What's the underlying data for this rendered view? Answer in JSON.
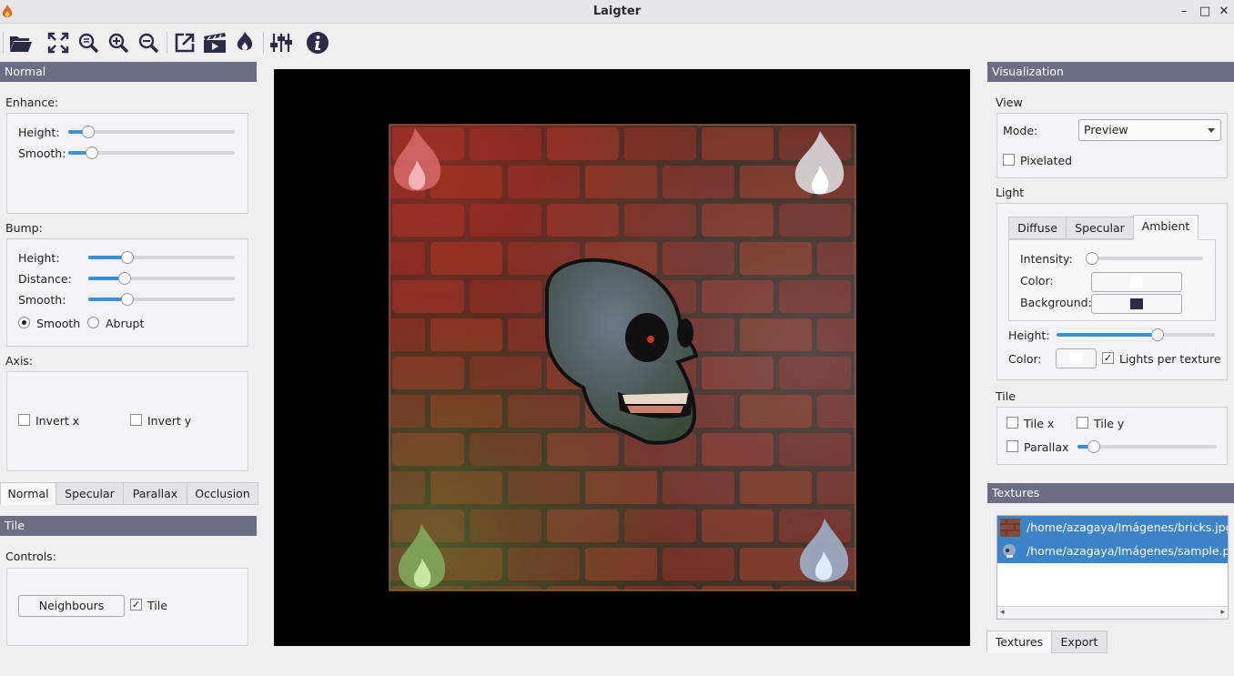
{
  "window": {
    "title": "Laigter"
  },
  "toolbar": {
    "items": [
      {
        "name": "open-folder-icon"
      },
      {
        "name": "fit-icon"
      },
      {
        "name": "zoom-reset-icon"
      },
      {
        "name": "zoom-in-icon"
      },
      {
        "name": "zoom-out-icon"
      },
      {
        "name": "export-icon"
      },
      {
        "name": "clapper-icon"
      },
      {
        "name": "flame-icon"
      },
      {
        "name": "sliders-icon"
      },
      {
        "name": "info-icon"
      }
    ]
  },
  "left": {
    "normal_header": "Normal",
    "enhance_label": "Enhance:",
    "enhance": {
      "height_label": "Height:",
      "smooth_label": "Smooth:",
      "height_value": 0.12,
      "smooth_value": 0.14
    },
    "bump_label": "Bump:",
    "bump": {
      "height_label": "Height:",
      "distance_label": "Distance:",
      "smooth_label": "Smooth:",
      "height_value": 0.27,
      "distance_value": 0.25,
      "smooth_value": 0.27,
      "smooth_radio": "Smooth",
      "abrupt_radio": "Abrupt"
    },
    "axis_label": "Axis:",
    "axis": {
      "invert_x": "Invert x",
      "invert_y": "Invert y"
    },
    "tabs": [
      "Normal",
      "Specular",
      "Parallax",
      "Occlusion"
    ],
    "tile_header": "Tile",
    "controls_label": "Controls:",
    "neighbours_button": "Neighbours",
    "tile_check": "Tile",
    "tile_check_mark": "✓"
  },
  "right": {
    "visualization_header": "Visualization",
    "view_label": "View",
    "mode_label": "Mode:",
    "mode_value": "Preview",
    "pixelated": "Pixelated",
    "light_label": "Light",
    "light_tabs": [
      "Diffuse",
      "Specular",
      "Ambient"
    ],
    "intensity_label": "Intensity:",
    "intensity_value": 0.0,
    "color_label": "Color:",
    "background_label": "Background:",
    "background_color": "#2e2c45",
    "height_label": "Height:",
    "height_value": 0.64,
    "color2_label": "Color:",
    "lights_per_texture": "Lights per texture",
    "lights_check_mark": "✓",
    "tile_label": "Tile",
    "tile_x": "Tile x",
    "tile_y": "Tile y",
    "parallax": "Parallax",
    "parallax_value": 0.12,
    "textures_header": "Textures",
    "textures": [
      "/home/azagaya/Imágenes/bricks.jpg",
      "/home/azagaya/Imágenes/sample.png"
    ],
    "bottom_tabs": [
      "Textures",
      "Export"
    ]
  },
  "colors": {
    "accent": "#3a8fd6",
    "header": "#6c6c82",
    "selection": "#3b84c8"
  }
}
